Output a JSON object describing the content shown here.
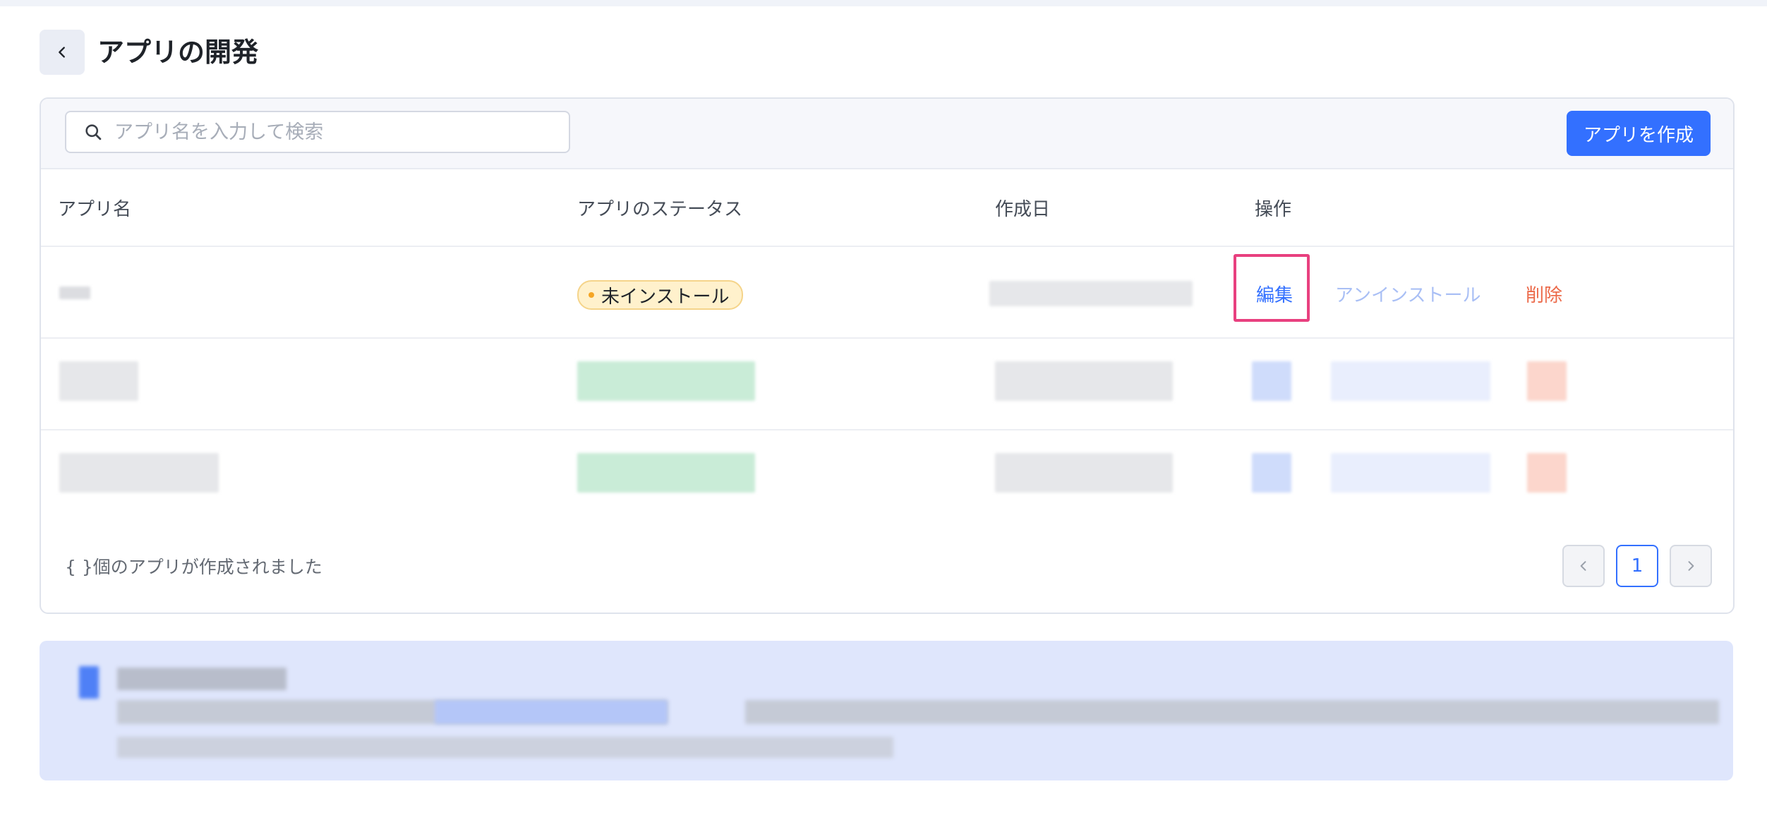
{
  "header": {
    "back_icon": "chevron-left-icon",
    "title": "アプリの開発"
  },
  "toolbar": {
    "search_icon": "search-icon",
    "search_placeholder": "アプリ名を入力して検索",
    "create_button": "アプリを作成"
  },
  "table": {
    "columns": [
      "アプリ名",
      "アプリのステータス",
      "作成日",
      "操作"
    ],
    "rows": [
      {
        "status": "未インストール",
        "actions": {
          "edit": "編集",
          "uninstall": "アンインストール",
          "delete": "削除"
        }
      }
    ]
  },
  "footer": {
    "count_text": "{ }個のアプリが作成されました",
    "prev_icon": "chevron-left-icon",
    "current_page": "1",
    "next_icon": "chevron-right-icon"
  },
  "colors": {
    "accent": "#3370ff",
    "highlight": "#e8407f",
    "danger": "#ec6a4a",
    "status_pending": "#f5a524"
  }
}
